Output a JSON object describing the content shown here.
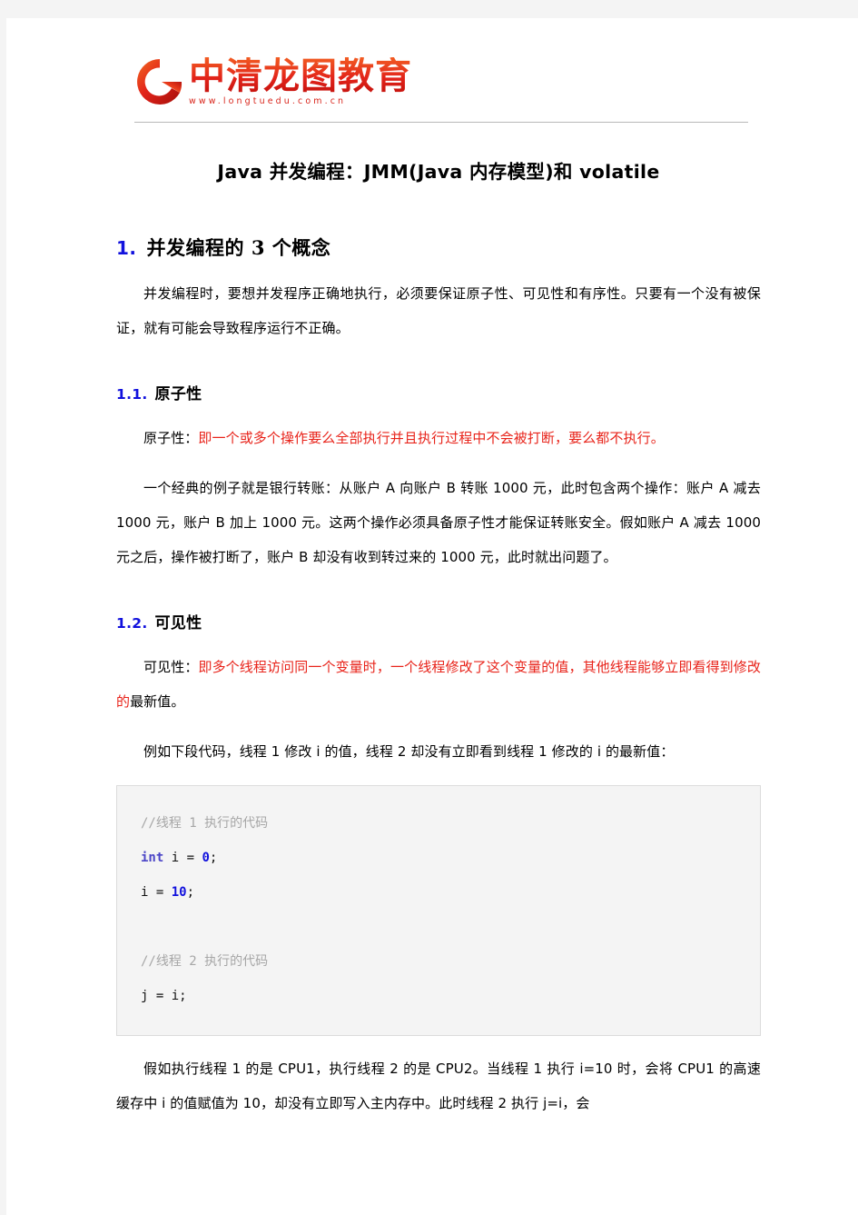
{
  "page": {
    "background_color": "#f4f4f4",
    "paper_color": "#ffffff"
  },
  "header": {
    "logo_icon": "circular-g-logo",
    "logo_name": "中清龙图教育",
    "logo_url": "www.longtuedu.com.cn",
    "logo_color": "#d9261c"
  },
  "document": {
    "title": "Java 并发编程：JMM(Java 内存模型)和 volatile",
    "sections": [
      {
        "number": "1.",
        "heading": "并发编程的 3 个概念",
        "paragraph": "并发编程时，要想并发程序正确地执行，必须要保证原子性、可见性和有序性。只要有一个没有被保证，就有可能会导致程序运行不正确。"
      }
    ],
    "subsections": [
      {
        "number": "1.1.",
        "heading": "原子性",
        "definition_label": "原子性：",
        "definition_red": "即一个或多个操作要么全部执行并且执行过程中不会被打断，要么都不执行。",
        "example": "一个经典的例子就是银行转账：从账户 A 向账户 B 转账 1000 元，此时包含两个操作：账户 A 减去 1000 元，账户 B 加上 1000 元。这两个操作必须具备原子性才能保证转账安全。假如账户 A 减去 1000 元之后，操作被打断了，账户 B 却没有收到转过来的 1000 元，此时就出问题了。"
      },
      {
        "number": "1.2.",
        "heading": "可见性",
        "definition_label": "可见性：",
        "definition_red": "即多个线程访问同一个变量时，一个线程修改了这个变量的值，其他线程能够立即看得到修改的",
        "definition_tail": "最新值。",
        "example": "例如下段代码，线程 1 修改 i 的值，线程 2 却没有立即看到线程 1 修改的 i 的最新值：",
        "closing": "假如执行线程 1 的是 CPU1，执行线程 2 的是 CPU2。当线程 1 执行 i=10  时，会将 CPU1 的高速缓存中 i 的值赋值为 10，却没有立即写入主内存中。此时线程 2 执行 j=i，会"
      }
    ],
    "code_block": {
      "language": "java",
      "lines": [
        {
          "type": "comment",
          "text": "//线程 1 执行的代码"
        },
        {
          "type": "code",
          "keyword": "int",
          "rest": " i = ",
          "number": "0",
          "tail": ";"
        },
        {
          "type": "code",
          "keyword": "",
          "rest": "i = ",
          "number": "10",
          "tail": ";"
        },
        {
          "type": "blank",
          "text": ""
        },
        {
          "type": "comment",
          "text": "//线程 2 执行的代码"
        },
        {
          "type": "plain",
          "text": "j = i;"
        }
      ],
      "comment_color": "#a6a6a6",
      "keyword_color": "#4b45c7",
      "number_color": "#1111dd",
      "background_color": "#f4f4f4"
    }
  }
}
